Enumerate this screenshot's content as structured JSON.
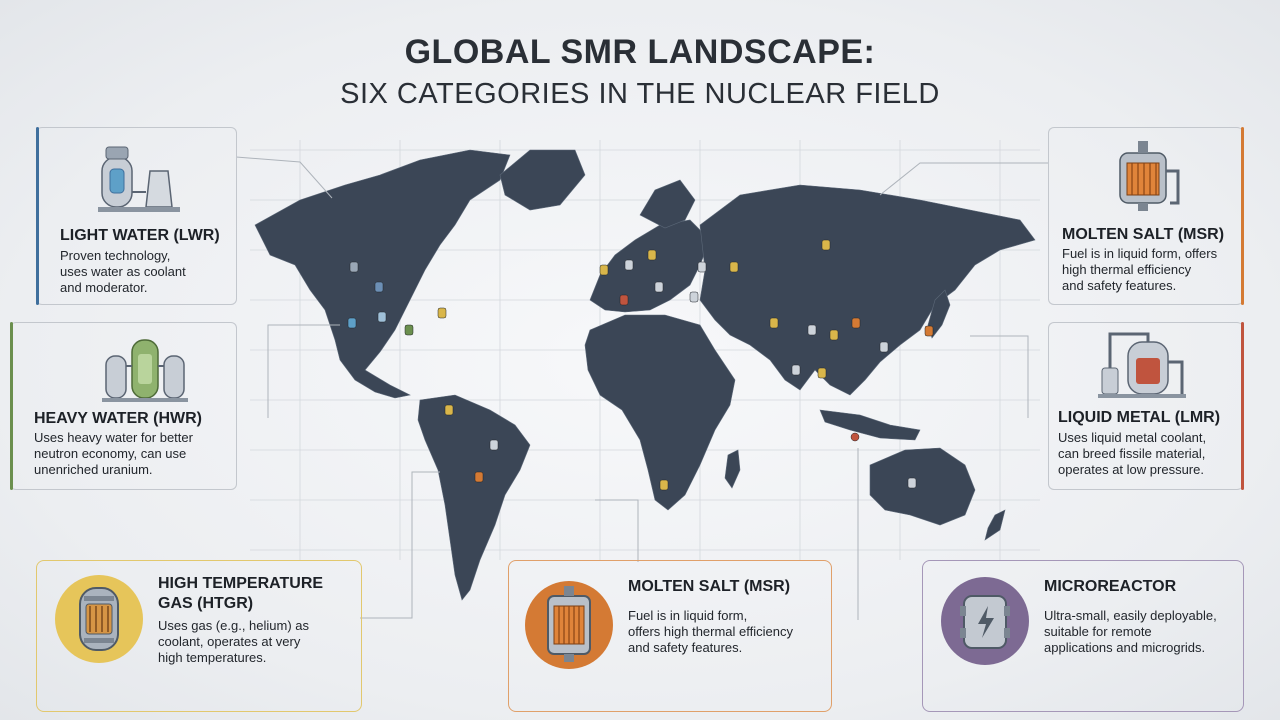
{
  "title": {
    "line1": "GLOBAL SMR LANDSCAPE:",
    "line2": "SIX CATEGORIES IN THE NUCLEAR FIELD"
  },
  "colors": {
    "land": "#3b4656",
    "lwr": "#3f6f9d",
    "hwr": "#6b8f4e",
    "htgr": "#d9b64a",
    "msr": "#d47a34",
    "lmr": "#c0543e",
    "micro": "#7d6a93"
  },
  "cards": {
    "lwr": {
      "icon": "reactor-cooling-tower-icon",
      "title": "LIGHT WATER (LWR)",
      "lines": [
        "Proven technology,",
        "uses water as coolant",
        "and moderator."
      ]
    },
    "hwr": {
      "icon": "heavy-water-reactor-icon",
      "title": "HEAVY WATER (HWR)",
      "lines": [
        "Uses heavy water for better",
        "neutron economy, can use",
        "unenriched uranium."
      ]
    },
    "htgr": {
      "icon": "gas-reactor-icon",
      "title_line1": "HIGH TEMPERATURE",
      "title_line2": "GAS (HTGR)",
      "lines": [
        "Uses gas (e.g., helium) as",
        "coolant, operates at very",
        "high temperatures."
      ]
    },
    "msr_bottom": {
      "icon": "molten-salt-reactor-icon",
      "title": "MOLTEN SALT (MSR)",
      "lines": [
        "Fuel is in liquid form,",
        "offers high thermal efficiency",
        "and safety features."
      ]
    },
    "micro": {
      "icon": "microreactor-battery-icon",
      "title": "MICROREACTOR",
      "lines": [
        "Ultra-small, easily deployable,",
        "suitable for remote",
        "applications and microgrids."
      ]
    },
    "msr_top": {
      "icon": "molten-salt-vessel-icon",
      "title": "MOLTEN SALT (MSR)",
      "lines": [
        "Fuel is in liquid form, offers",
        "high thermal efficiency",
        "and safety features."
      ]
    },
    "lmr": {
      "icon": "liquid-metal-reactor-icon",
      "title": "LIQUID METAL (LMR)",
      "lines": [
        "Uses liquid metal coolant,",
        "can breed fissile material,",
        "operates at low pressure."
      ]
    }
  }
}
